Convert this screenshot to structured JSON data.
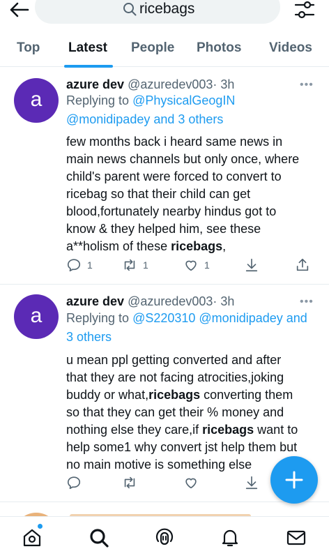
{
  "search": {
    "query": "ricebags"
  },
  "tabs": [
    {
      "label": "Top"
    },
    {
      "label": "Latest",
      "active": true
    },
    {
      "label": "People"
    },
    {
      "label": "Photos"
    },
    {
      "label": "Videos"
    }
  ],
  "tweets": [
    {
      "avatar_letter": "a",
      "name": "azure dev",
      "handle": "@azuredev003",
      "time": "· 3h",
      "more": "•••",
      "reply_prefix": "Replying to ",
      "mention_1": "@PhysicalGeogIN",
      "reply_line2_mention": "@monidipadey",
      "reply_line2_rest": " and 3 others",
      "body_part1": "few months back i heard same news in\nmain news channels but only once, where\nchild's parent were forced to convert to\nricebag so that their child can get\nblood,fortunately nearby hindus got to\nknow & they helped him, see these\na**holism of these ",
      "body_bold": "ricebags",
      "body_part2": ",",
      "replies": "1",
      "retweets": "1",
      "likes": "1"
    },
    {
      "avatar_letter": "a",
      "name": "azure dev",
      "handle": "@azuredev003",
      "time": "· 3h",
      "more": "•••",
      "reply_prefix": "Replying to ",
      "mention_1": "@S220310 @monidipadey",
      "mention_1_rest": " and",
      "reply_line2": "3 others",
      "body_part1": "u mean ppl getting converted and after\nthat they are not facing atrocities,joking\nbuddy or what,",
      "body_bold1": "ricebags",
      "body_part2": " converting them\nso that they can get their % money and\nnothing else they care,if ",
      "body_bold2": "ricebags",
      "body_part3": " want to\nhelp some1 why convert jst help them but\nno main motive is something else"
    }
  ],
  "icons": {
    "back": "arrow-left-icon",
    "search": "search-icon",
    "filter": "filter-sliders-icon",
    "reply": "reply-icon",
    "retweet": "retweet-icon",
    "like": "heart-icon",
    "save": "download-icon",
    "share": "share-icon",
    "compose": "plus-icon",
    "home": "home-icon",
    "explore": "search-icon",
    "spaces": "spaces-icon",
    "notifications": "bell-icon",
    "messages": "mail-icon"
  },
  "colors": {
    "accent": "#1d9bf0",
    "avatar": "#5b2ab5",
    "muted": "#536471"
  }
}
